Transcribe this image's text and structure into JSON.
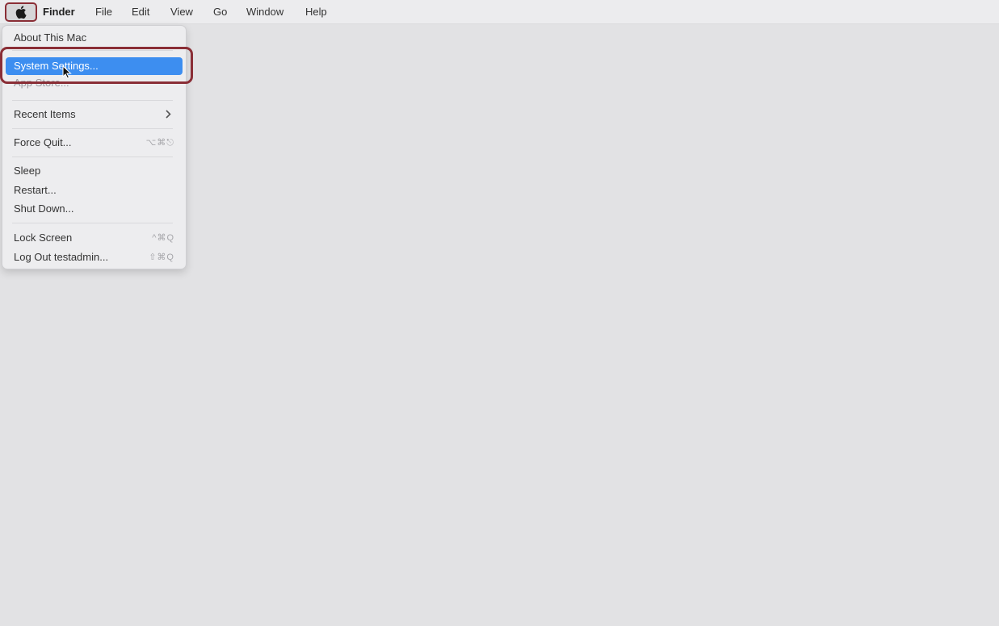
{
  "menubar": {
    "apple_icon": "apple-logo-icon",
    "app_name": "Finder",
    "menus": [
      "File",
      "Edit",
      "View",
      "Go",
      "Window",
      "Help"
    ]
  },
  "apple_menu": {
    "items": [
      {
        "label": "About This Mac"
      },
      {
        "label": "System Settings...",
        "highlighted": true
      },
      {
        "label": "App Store..."
      },
      {
        "label": "Recent Items",
        "has_submenu": true
      },
      {
        "label": "Force Quit...",
        "shortcut": "⌥⌘⎋"
      },
      {
        "label": "Sleep"
      },
      {
        "label": "Restart..."
      },
      {
        "label": "Shut Down..."
      },
      {
        "label": "Lock Screen",
        "shortcut": "^⌘Q"
      },
      {
        "label": "Log Out testadmin...",
        "shortcut": "⇧⌘Q"
      }
    ]
  },
  "colors": {
    "highlight": "#3d8ef0",
    "annotation": "#8a2e36",
    "desktop": "#e2e2e4"
  }
}
